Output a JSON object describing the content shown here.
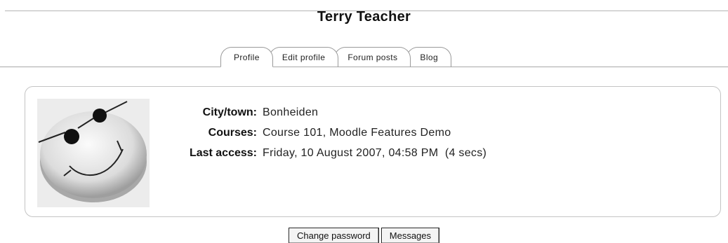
{
  "user": {
    "full_name": "Terry Teacher"
  },
  "tabs": [
    {
      "label": "Profile",
      "active": true
    },
    {
      "label": "Edit profile",
      "active": false
    },
    {
      "label": "Forum posts",
      "active": false
    },
    {
      "label": "Blog",
      "active": false
    }
  ],
  "profile": {
    "avatar_icon": "smiley-face-sunglasses-icon",
    "fields": [
      {
        "label": "City/town:",
        "value": "Bonheiden"
      },
      {
        "label": "Courses:",
        "value": "Course 101, Moodle Features Demo"
      },
      {
        "label": "Last access:",
        "value": "Friday, 10 August 2007, 04:58 PM  (4 secs)"
      }
    ]
  },
  "actions": {
    "change_password": "Change password",
    "messages": "Messages"
  }
}
